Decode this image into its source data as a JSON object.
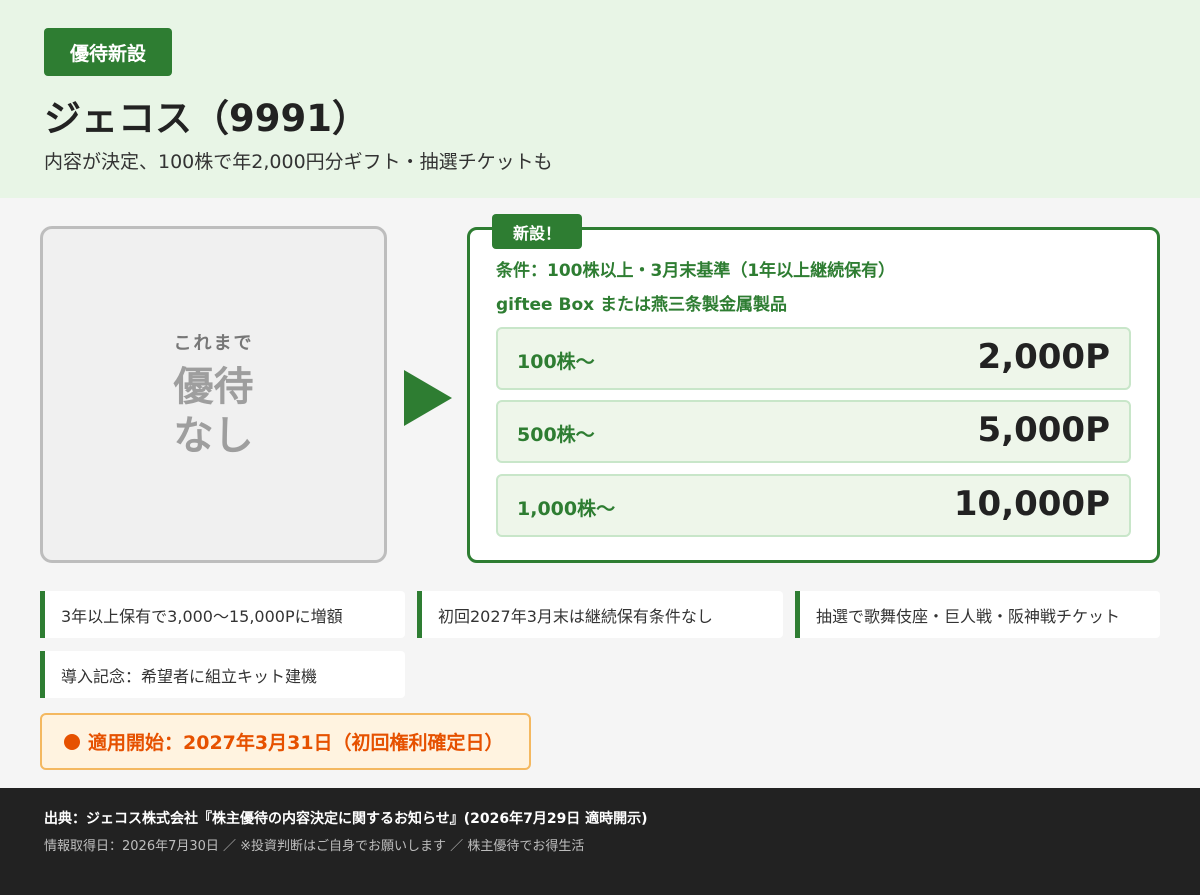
{
  "header": {
    "badge": "優待新設",
    "title": "ジェコス（9991）",
    "subtitle": "内容が決定、100株で年2,000円分ギフト・抽選チケットも"
  },
  "before": {
    "label": "これまで",
    "line1": "優待",
    "line2": "なし"
  },
  "after": {
    "tag": "新設！",
    "condition": "条件：100株以上・3月末基準（1年以上継続保有）",
    "gift": "giftee Box または燕三条製金属製品",
    "tiers": [
      {
        "shares": "100株〜",
        "points": "2,000P"
      },
      {
        "shares": "500株〜",
        "points": "5,000P"
      },
      {
        "shares": "1,000株〜",
        "points": "10,000P"
      }
    ]
  },
  "notes": [
    "3年以上保有で3,000〜15,000Pに増額",
    "初回2027年3月末は継続保有条件なし",
    "抽選で歌舞伎座・巨人戦・阪神戦チケット",
    "導入記念：希望者に組立キット建機"
  ],
  "start": "適用開始：2027年3月31日（初回権利確定日）",
  "footer": {
    "source": "出典：ジェコス株式会社『株主優待の内容決定に関するお知らせ』(2026年7月29日 適時開示)",
    "info": "情報取得日：2026年7月30日 ／ ※投資判断はご自身でお願いします ／ 株主優待でお得生活"
  },
  "colors": {
    "accent_green": "#2e7d32",
    "header_bg": "#e8f5e6",
    "tier_bg": "#eef6ea",
    "start_orange": "#e65100",
    "footer_bg": "#222222"
  }
}
